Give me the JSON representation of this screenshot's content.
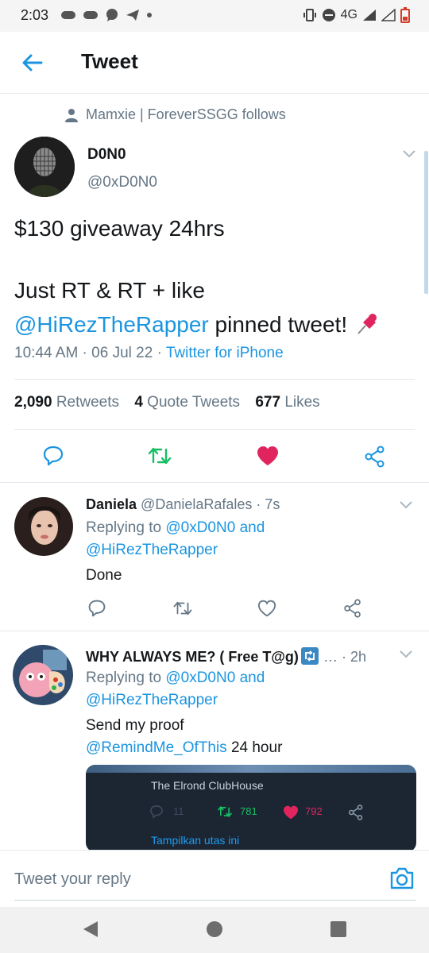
{
  "status_bar": {
    "time": "2:03",
    "network": "4G"
  },
  "header": {
    "title": "Tweet"
  },
  "tweet": {
    "social_context": "Mamxie | ForeverSSGG follows",
    "display_name": "D0N0",
    "handle": "@0xD0N0",
    "text_line1": "$130 giveaway 24hrs",
    "text_line2": "Just RT & RT + like",
    "mention": "@HiRezTheRapper",
    "text_line3_rest": " pinned tweet! ",
    "time": "10:44 AM",
    "date": "06 Jul 22",
    "source": "Twitter for iPhone",
    "retweets_count": "2,090",
    "retweets_label": "Retweets",
    "quotes_count": "4",
    "quotes_label": "Quote Tweets",
    "likes_count": "677",
    "likes_label": "Likes",
    "liked": true,
    "colors": {
      "accent": "#1b95e0",
      "retweet": "#17bf63",
      "like": "#e0245e"
    }
  },
  "replies": [
    {
      "display_name": "Daniela",
      "handle": "@DanielaRafales",
      "time": "7s",
      "replying_prefix": "Replying to",
      "replying_user1": "@0xD0N0",
      "replying_and": "and",
      "replying_user2": "@HiRezTheRapper",
      "text": "Done"
    },
    {
      "display_name": "WHY ALWAYS ME? ( Free T@g)",
      "ellipsis": "…",
      "time": "2h",
      "replying_prefix": "Replying to",
      "replying_user1": "@0xD0N0",
      "replying_and": "and",
      "replying_user2": "@HiRezTheRapper",
      "text_line1": "Send my proof",
      "mention": "@RemindMe_OfThis",
      "text_line2_rest": " 24 hour",
      "embed": {
        "title": "The Elrond ClubHouse",
        "replies": "11",
        "retweets": "781",
        "likes": "792",
        "link": "Tampilkan utas ini"
      }
    }
  ],
  "reply_box": {
    "placeholder": "Tweet your reply"
  }
}
